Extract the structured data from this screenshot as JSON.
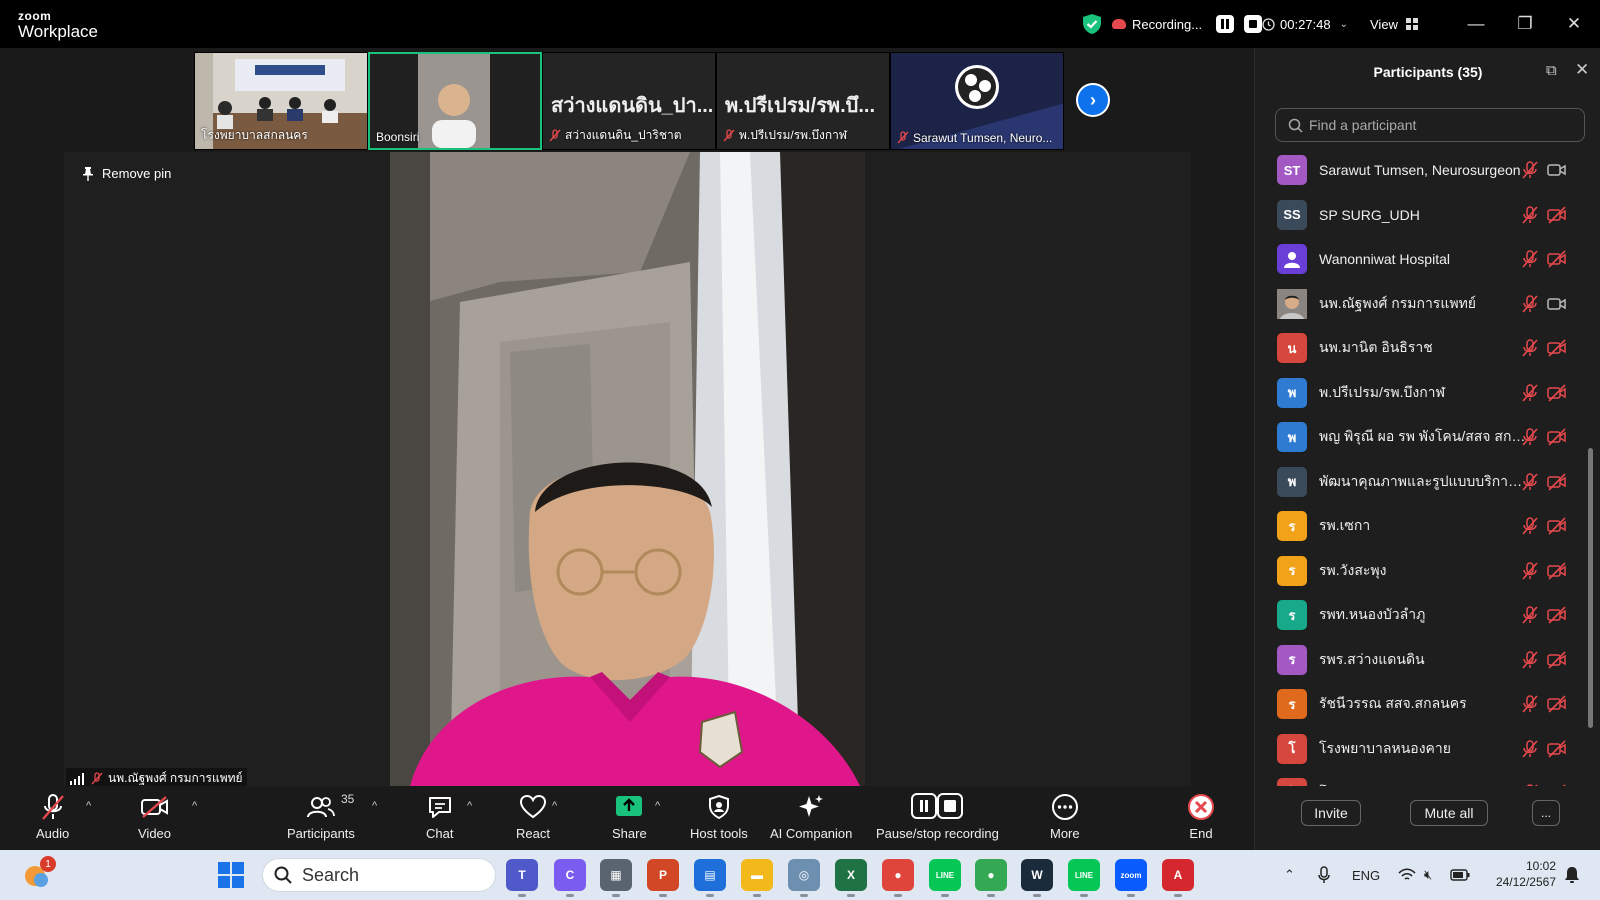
{
  "window": {
    "brand_top": "zoom",
    "brand_bottom": "Workplace",
    "recording_label": "Recording...",
    "timer": "00:27:48",
    "view_label": "View"
  },
  "thumbnails": [
    {
      "caption": "โรงพยาบาลสกลนคร",
      "muted": false,
      "kind": "room"
    },
    {
      "caption": "Boonsiri",
      "muted": false,
      "kind": "person",
      "active": true
    },
    {
      "big_name": "สว่างแดนดิน_ปา...",
      "caption": "สว่างแดนดิน_ปาริชาต",
      "muted": true
    },
    {
      "big_name": "พ.ปรีเปรม/รพ.บึ...",
      "caption": "พ.ปรีเปรม/รพ.บึงกาฬ",
      "muted": true
    },
    {
      "caption": "Sarawut Tumsen, Neuro...",
      "muted": true,
      "kind": "logo"
    }
  ],
  "stage": {
    "pin_label": "Remove pin",
    "speaker_name": "นพ.ณัฐพงศ์ กรมการแพทย์"
  },
  "toolbar": {
    "audio": "Audio",
    "video": "Video",
    "participants": "Participants",
    "participants_count": "35",
    "chat": "Chat",
    "react": "React",
    "share": "Share",
    "host_tools": "Host tools",
    "ai_companion": "AI Companion",
    "pause_stop_recording": "Pause/stop recording",
    "more": "More",
    "end": "End"
  },
  "sidebar": {
    "title": "Participants (35)",
    "search_placeholder": "Find a participant",
    "invite": "Invite",
    "mute_all": "Mute all",
    "more": "...",
    "participants": [
      {
        "initials": "ST",
        "name": "Sarawut Tumsen, Neurosurgeon",
        "color": "#a259c4",
        "mic": "muted",
        "cam": "on"
      },
      {
        "initials": "SS",
        "name": "SP SURG_UDH",
        "color": "#3b4a5a",
        "mic": "muted",
        "cam": "off"
      },
      {
        "initials": "",
        "name": "Wanonniwat Hospital",
        "color": "#6a3fd8",
        "mic": "muted",
        "cam": "off",
        "avatar": "person"
      },
      {
        "initials": "",
        "name": "นพ.ณัฐพงศ์ กรมการแพทย์",
        "color": "#555555",
        "mic": "muted",
        "cam": "on",
        "avatar": "photo"
      },
      {
        "initials": "น",
        "name": "นพ.มานิต อินธิราช",
        "color": "#d6473d",
        "mic": "muted",
        "cam": "off"
      },
      {
        "initials": "พ",
        "name": "พ.ปรีเปรม/รพ.บึงกาฬ",
        "color": "#2f7bd1",
        "mic": "muted",
        "cam": "off"
      },
      {
        "initials": "พ",
        "name": "พญ พิรุณี ผอ รพ พังโคน/สสจ สกลน...",
        "color": "#2f7bd1",
        "mic": "muted",
        "cam": "off"
      },
      {
        "initials": "พ",
        "name": "พัฒนาคุณภาพและรูปแบบบริการ สส...",
        "color": "#3b4a5a",
        "mic": "muted",
        "cam": "off"
      },
      {
        "initials": "ร",
        "name": "รพ.เซกา",
        "color": "#f2a218",
        "mic": "muted",
        "cam": "off"
      },
      {
        "initials": "ร",
        "name": "รพ.วังสะพุง",
        "color": "#f2a218",
        "mic": "muted",
        "cam": "off"
      },
      {
        "initials": "ร",
        "name": "รพท.หนองบัวลำภู",
        "color": "#17a98a",
        "mic": "muted",
        "cam": "off"
      },
      {
        "initials": "ร",
        "name": "รพร.สว่างแดนดิน",
        "color": "#a259c4",
        "mic": "muted",
        "cam": "off"
      },
      {
        "initials": "ร",
        "name": "รัชนีวรรณ สสจ.สกลนคร",
        "color": "#e06a1b",
        "mic": "muted",
        "cam": "off"
      },
      {
        "initials": "โ",
        "name": "โรงพยาบาลหนองคาย",
        "color": "#d6473d",
        "mic": "muted",
        "cam": "off"
      },
      {
        "initials": "โ",
        "name": "โรงพยาบาลหนองคาย",
        "color": "#d6473d",
        "mic": "muted",
        "cam": "off"
      }
    ]
  },
  "taskbar": {
    "search_label": "Search",
    "notification_count": "1",
    "language": "ENG",
    "time": "10:02",
    "date": "24/12/2567",
    "apps": [
      {
        "name": "teams-icon",
        "color": "#5059c9",
        "glyph": "T"
      },
      {
        "name": "copilot-icon",
        "color": "#7b5cf0",
        "glyph": "C"
      },
      {
        "name": "calculator-icon",
        "color": "#5a6470",
        "glyph": "▦"
      },
      {
        "name": "powerpoint-icon",
        "color": "#d24726",
        "glyph": "P"
      },
      {
        "name": "calendar-icon",
        "color": "#1e6fd9",
        "glyph": "▤"
      },
      {
        "name": "file-explorer-icon",
        "color": "#f3b81a",
        "glyph": "▬"
      },
      {
        "name": "wifi-app-icon",
        "color": "#6d8fb0",
        "glyph": "◎"
      },
      {
        "name": "excel-icon",
        "color": "#1f7244",
        "glyph": "X"
      },
      {
        "name": "chrome-icon",
        "color": "#e0453b",
        "glyph": "●"
      },
      {
        "name": "line-icon",
        "color": "#06c755",
        "glyph": "LINE"
      },
      {
        "name": "chrome-profile-icon",
        "color": "#34a853",
        "glyph": "●"
      },
      {
        "name": "webex-icon",
        "color": "#1a2b3c",
        "glyph": "W"
      },
      {
        "name": "line-active-icon",
        "color": "#06c755",
        "glyph": "LINE"
      },
      {
        "name": "zoom-icon",
        "color": "#0b5cff",
        "glyph": "zoom"
      },
      {
        "name": "acrobat-icon",
        "color": "#d4272e",
        "glyph": "A"
      }
    ]
  }
}
